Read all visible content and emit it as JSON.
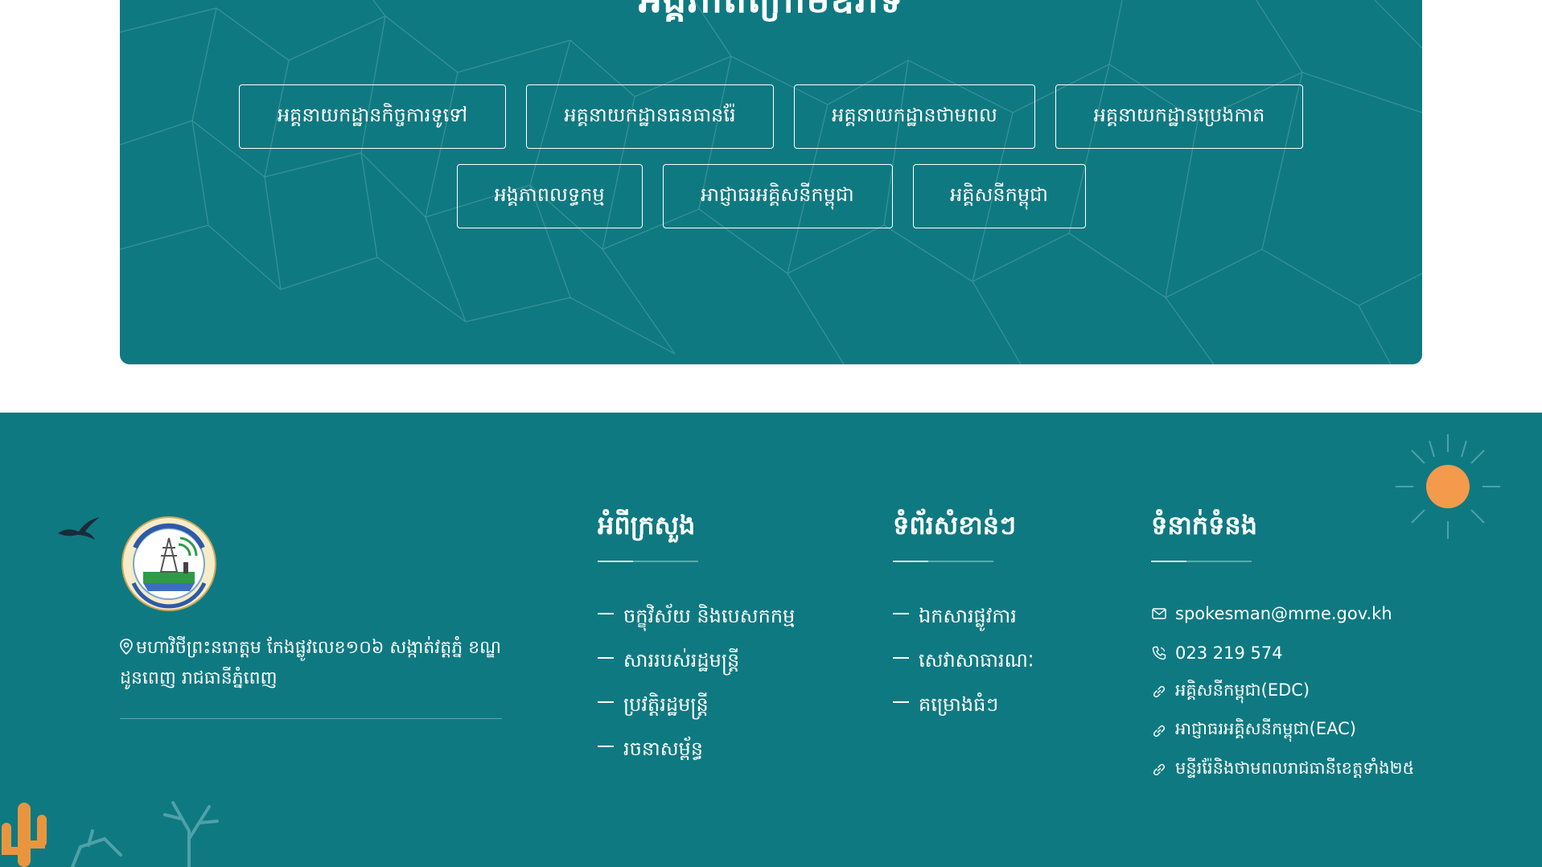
{
  "agencies": {
    "title": "អង្គភាពក្រោមឱវាទ",
    "row1": [
      "អគ្គនាយកដ្ឋានកិច្ចការទូទៅ",
      "អគ្គនាយកដ្ឋានធនធានរ៉ែ",
      "អគ្គនាយកដ្ឋានថាមពល",
      "អគ្គនាយកដ្ឋានប្រេងកាត"
    ],
    "row2": [
      "អង្គភាពលទ្ធកម្ម",
      "អាជ្ញាធរអគ្គិសនីកម្ពុជា",
      "អគ្គិសនីកម្ពុជា"
    ]
  },
  "footer": {
    "logo_icon": "ministry-of-mines-and-energy-logo",
    "logo_ring_text": "MINISTRY OF MINES AND ENERGY",
    "address": "មហាវិថីព្រះនរោត្តម កែងផ្លូវលេខ១០៦ សង្កាត់វត្តភ្នំ ខណ្ឌដូនពេញ រាជធានីភ្នំពេញ",
    "about": {
      "title": "អំពីក្រសួង",
      "items": [
        "ចក្ខុវិស័យ និងបេសកកម្ម",
        "សាររបស់រដ្ឋមន្ត្រី",
        "ប្រវត្តិរដ្ឋមន្ត្រី",
        "រចនាសម្ព័ន្ធ"
      ]
    },
    "links": {
      "title": "ទំព័រសំខាន់ៗ",
      "items": [
        "ឯកសារផ្លូវការ",
        "សេវាសាធារណៈ",
        "គម្រោងធំៗ"
      ]
    },
    "contact": {
      "title": "ទំនាក់ទំនង",
      "email": "spokesman@mme.gov.kh",
      "phone": "023 219 574",
      "links": [
        "អគ្គិសនីកម្ពុជា(EDC)",
        "អាជ្ញាធរអគ្គិសនីកម្ពុជា(EAC)",
        "មន្ទីររ៉ែនិងថាមពលរាជធានីខេត្តទាំង២៥"
      ]
    },
    "colors": {
      "teal": "#0f7981",
      "sun": "#f39a4d",
      "cactus": "#e8963e"
    }
  }
}
